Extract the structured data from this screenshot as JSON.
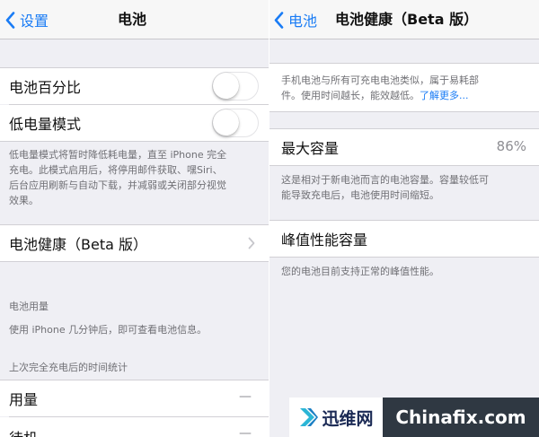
{
  "left": {
    "nav": {
      "back_label": "设置",
      "title": "电池"
    },
    "battery_percentage": {
      "label": "电池百分比",
      "enabled": false
    },
    "low_power_mode": {
      "label": "低电量模式",
      "enabled": false
    },
    "low_power_note": [
      "低电量模式将暂时降低耗电量，直至 iPhone 完全",
      "充电。此模式启用后，将停用邮件获取、嘿Siri、",
      "后台应用刷新与自动下载，并减弱或关闭部分视觉",
      "效果。"
    ],
    "battery_health_cell": {
      "label": "电池健康（Beta 版）",
      "chevron_icon": "chevron-right-icon"
    },
    "usage_header": "电池用量",
    "usage_note": "使用 iPhone 几分钟后，即可查看电池信息。",
    "stats_header": "上次完全充电后的时间统计",
    "stats": [
      {
        "label": "用量",
        "value": "—"
      },
      {
        "label": "待机",
        "value": "—"
      }
    ]
  },
  "right": {
    "nav": {
      "back_label": "电池",
      "title": "电池健康（Beta 版）"
    },
    "intro_note": {
      "line1": "手机电池与所有可充电电池类似，属于易耗部",
      "line2": "件。使用时间越长，能效越低。",
      "link": "了解更多..."
    },
    "max_capacity": {
      "label": "最大容量",
      "value": "86%"
    },
    "capacity_note": [
      "这是相对于新电池而言的电池容量。容量较低可",
      "能导致充电后，电池使用时间缩短。"
    ],
    "peak_performance": {
      "label": "峰值性能容量"
    },
    "peak_note": "您的电池目前支持正常的峰值性能。"
  },
  "watermark": {
    "cn": "迅维网",
    "en": "Chinafix.com"
  },
  "colors": {
    "ios_blue": "#1a7cf5",
    "group_background": "#efeff4",
    "secondary_text": "#707075"
  }
}
